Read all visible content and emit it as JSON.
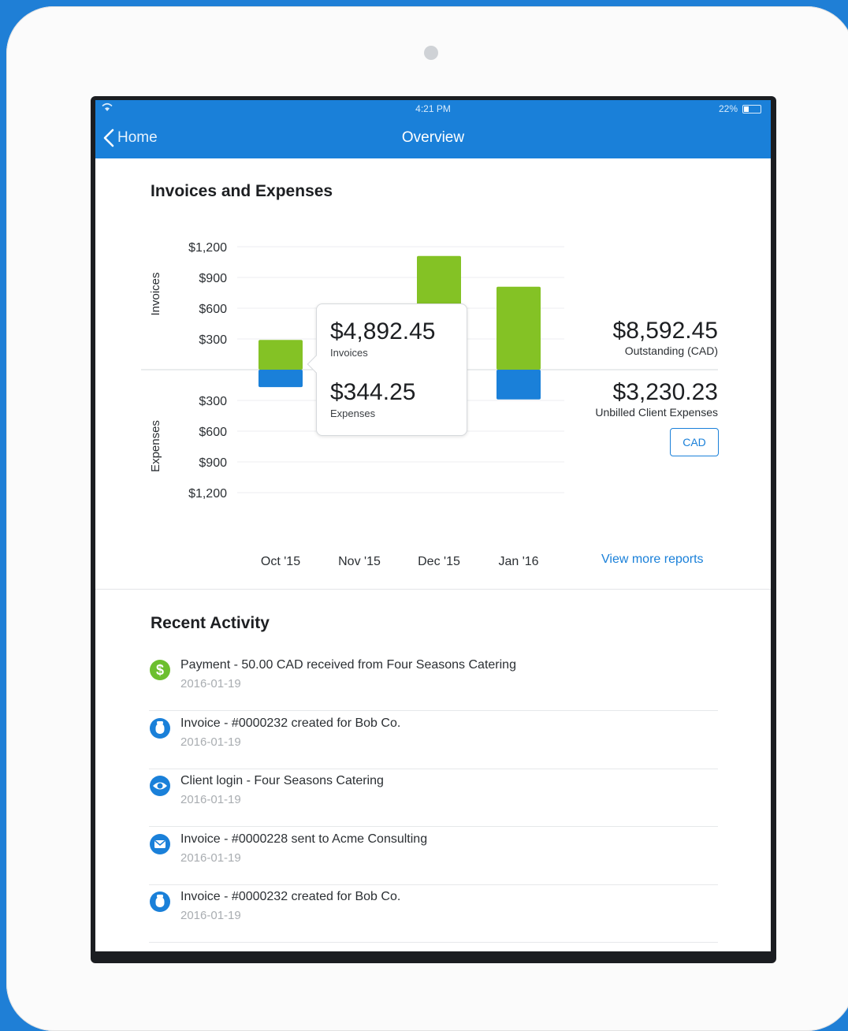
{
  "status_bar": {
    "time": "4:21 PM",
    "battery": "22%"
  },
  "navbar": {
    "back_label": "Home",
    "title": "Overview"
  },
  "chart_section": {
    "title": "Invoices and Expenses",
    "tooltip": {
      "invoices_value": "$4,892.45",
      "invoices_label": "Invoices",
      "expenses_value": "$344.25",
      "expenses_label": "Expenses"
    },
    "outstanding_value": "$8,592.45",
    "outstanding_label": "Outstanding (CAD)",
    "unbilled_value": "$3,230.23",
    "unbilled_label": "Unbilled Client Expenses",
    "currency_button": "CAD",
    "view_more_link": "View more reports"
  },
  "chart_data": {
    "type": "bar",
    "categories": [
      "Oct '15",
      "Nov '15",
      "Dec '15",
      "Jan '16"
    ],
    "series": [
      {
        "name": "Invoices",
        "values": [
          290,
          0,
          1110,
          810
        ],
        "color": "#84c225"
      },
      {
        "name": "Expenses",
        "values": [
          170,
          0,
          0,
          290
        ],
        "color": "#1a80d9"
      }
    ],
    "y_ticks_invoices": [
      "$1,200",
      "$900",
      "$600",
      "$300"
    ],
    "y_ticks_expenses": [
      "$300",
      "$600",
      "$900",
      "$1,200"
    ],
    "ylabel_top": "Invoices",
    "ylabel_bottom": "Expenses",
    "ylim": [
      -1200,
      1200
    ],
    "grid": true
  },
  "recent_activity": {
    "title": "Recent Activity",
    "items": [
      {
        "icon": "dollar-icon",
        "color": "#6cbf2e",
        "text": "Payment - 50.00 CAD received from Four Seasons Catering",
        "date": "2016-01-19"
      },
      {
        "icon": "invoice-icon",
        "color": "#1a80d9",
        "text": "Invoice - #0000232 created for Bob Co.",
        "date": "2016-01-19"
      },
      {
        "icon": "eye-icon",
        "color": "#1a80d9",
        "text": "Client login - Four Seasons Catering",
        "date": "2016-01-19"
      },
      {
        "icon": "mail-icon",
        "color": "#1a80d9",
        "text": "Invoice - #0000228 sent to Acme Consulting",
        "date": "2016-01-19"
      },
      {
        "icon": "invoice-icon",
        "color": "#1a80d9",
        "text": "Invoice - #0000232 created for Bob Co.",
        "date": "2016-01-19"
      }
    ]
  }
}
